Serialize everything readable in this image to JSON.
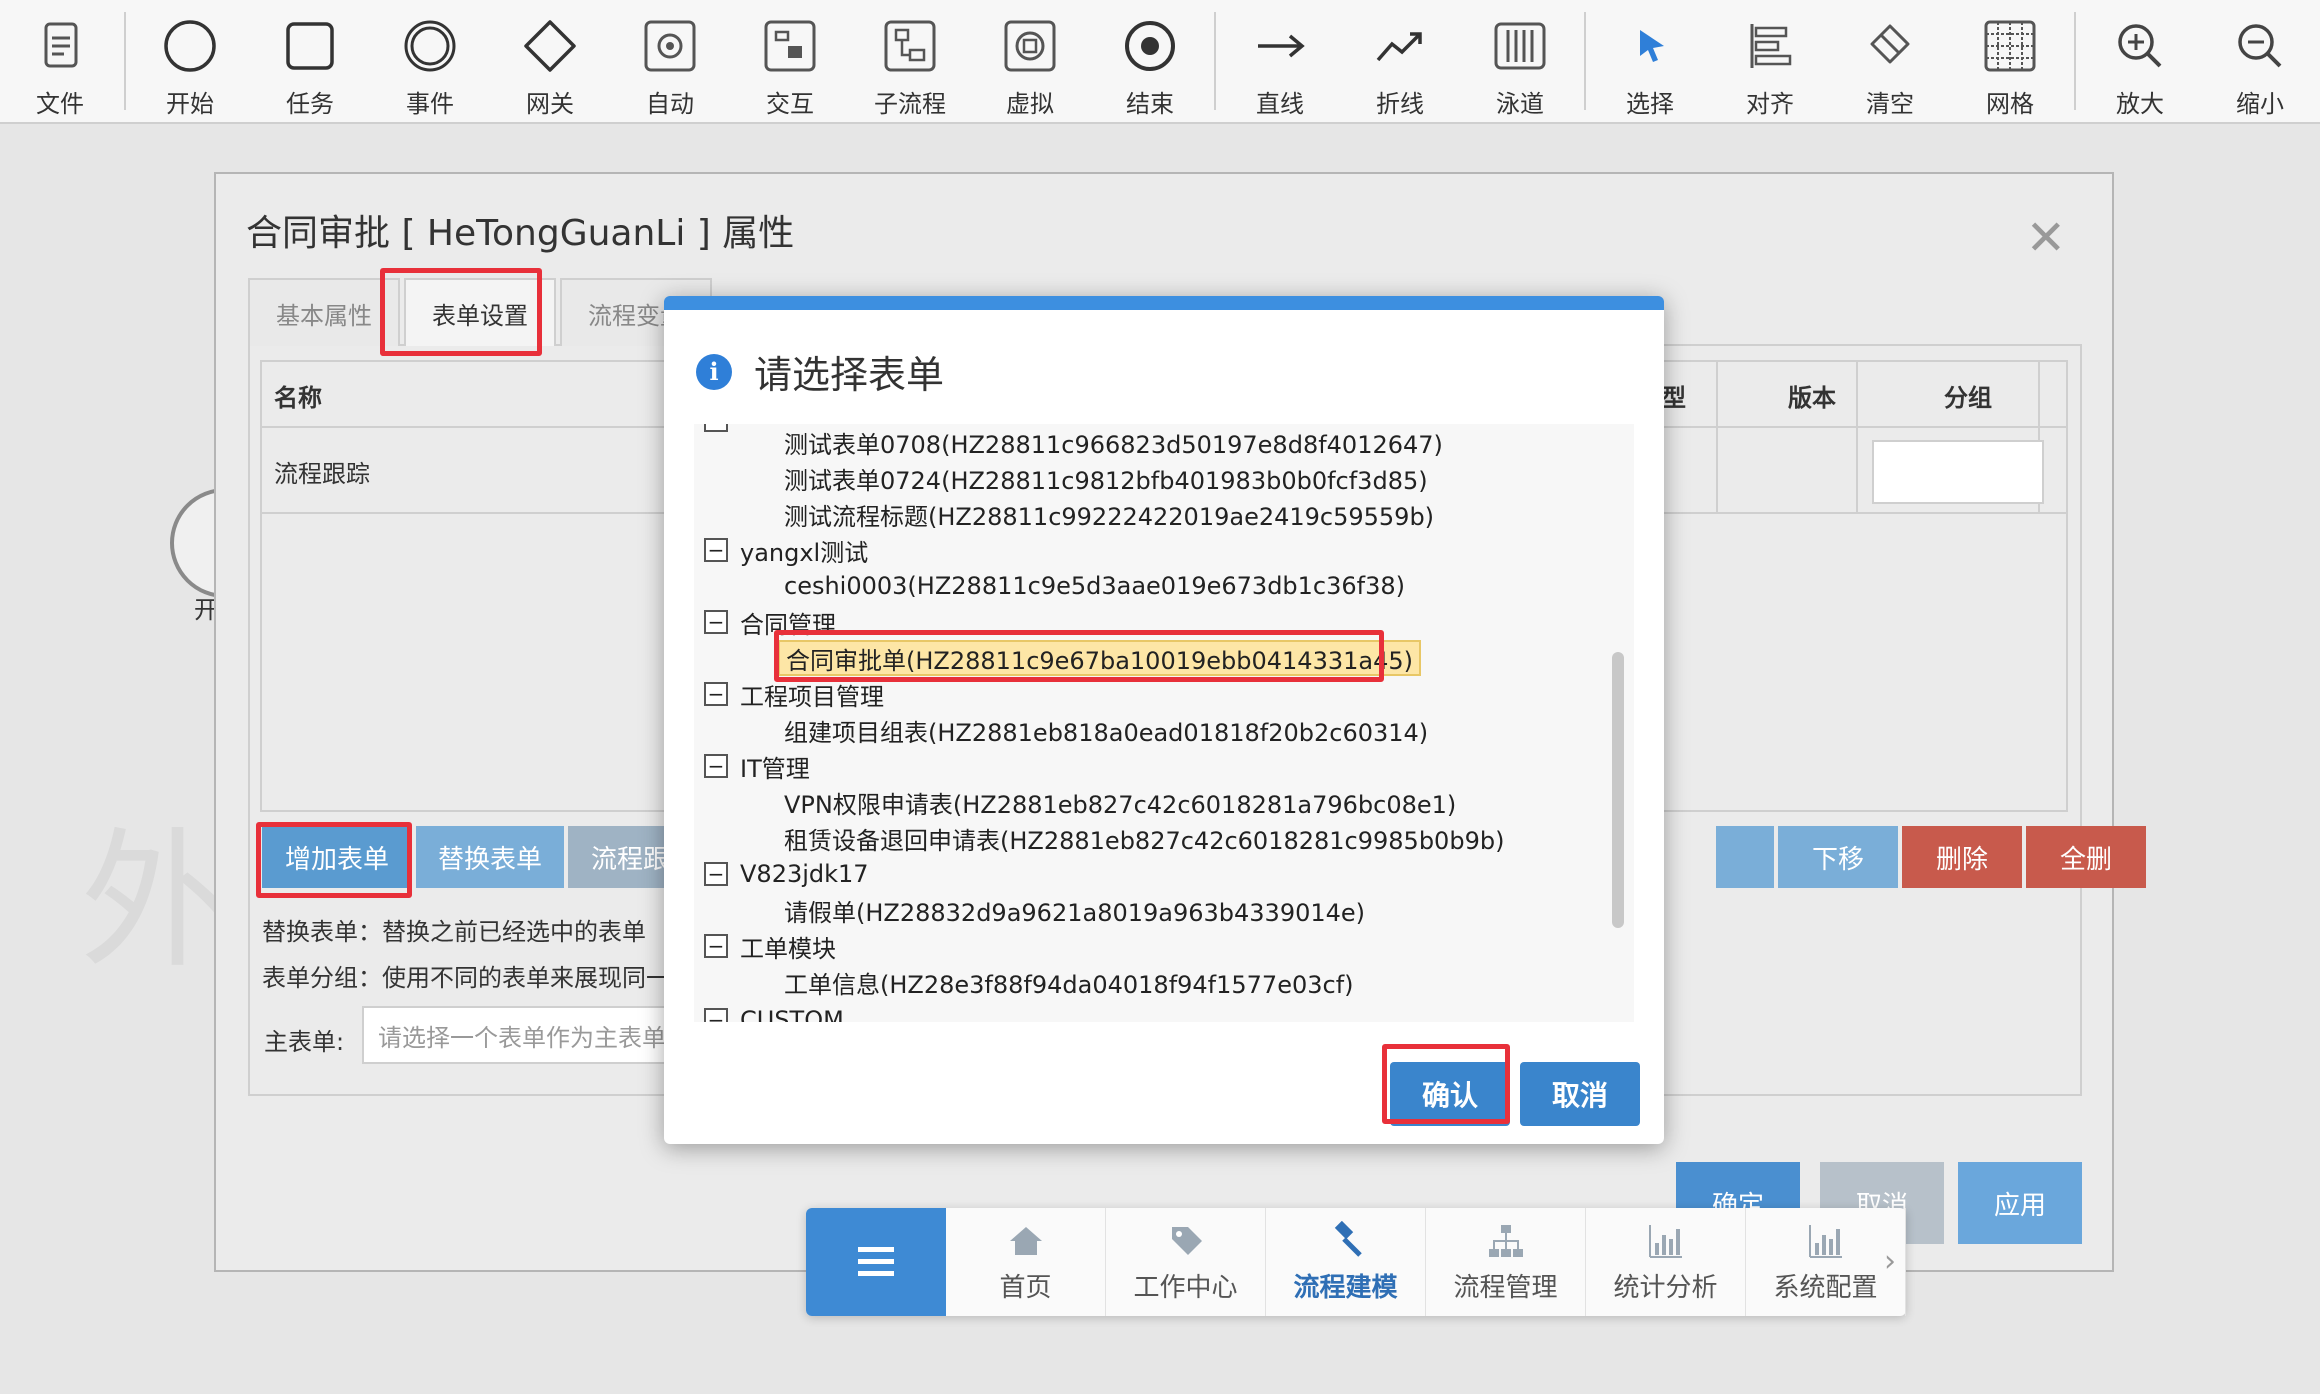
{
  "toolbar": {
    "items": [
      {
        "id": "file",
        "label": "文件",
        "icon": "file-icon"
      },
      {
        "id": "start",
        "label": "开始",
        "icon": "start-circle-icon"
      },
      {
        "id": "task",
        "label": "任务",
        "icon": "task-square-icon"
      },
      {
        "id": "event",
        "label": "事件",
        "icon": "event-ring-icon"
      },
      {
        "id": "gateway",
        "label": "网关",
        "icon": "gateway-diamond-icon"
      },
      {
        "id": "auto",
        "label": "自动",
        "icon": "gear-icon"
      },
      {
        "id": "interact",
        "label": "交互",
        "icon": "interact-icon"
      },
      {
        "id": "subprocess",
        "label": "子流程",
        "icon": "subprocess-icon"
      },
      {
        "id": "virtual",
        "label": "虚拟",
        "icon": "virtual-icon"
      },
      {
        "id": "end",
        "label": "结束",
        "icon": "end-circle-icon"
      },
      {
        "id": "line",
        "label": "直线",
        "icon": "arrow-right-icon"
      },
      {
        "id": "polyline",
        "label": "折线",
        "icon": "polyline-icon"
      },
      {
        "id": "lane",
        "label": "泳道",
        "icon": "swimlane-icon"
      },
      {
        "id": "select",
        "label": "选择",
        "icon": "pointer-icon"
      },
      {
        "id": "align",
        "label": "对齐",
        "icon": "align-icon"
      },
      {
        "id": "clear",
        "label": "清空",
        "icon": "eraser-icon"
      },
      {
        "id": "grid",
        "label": "网格",
        "icon": "grid-icon"
      },
      {
        "id": "zoomin",
        "label": "放大",
        "icon": "zoom-in-icon"
      },
      {
        "id": "zoomout",
        "label": "缩小",
        "icon": "zoom-out-icon"
      }
    ]
  },
  "canvas": {
    "node_label": "开",
    "watermark": "外"
  },
  "prop_dialog": {
    "title": "合同审批 [ HeTongGuanLi ] 属性",
    "close": "✕",
    "tabs": [
      "基本属性",
      "表单设置",
      "流程变量"
    ],
    "table": {
      "headers": {
        "name": "名称",
        "type_partial": "型",
        "version": "版本",
        "group": "分组"
      },
      "rows": [
        {
          "name": "流程跟踪"
        }
      ]
    },
    "buttons": {
      "add": "增加表单",
      "replace": "替换表单",
      "track_partial": "流程跟踪",
      "down": "下移",
      "delete": "删除",
      "delete_all": "全删"
    },
    "help_replace": "替换表单：替换之前已经选中的表单",
    "help_group": "表单分组：使用不同的表单来展现同一",
    "main_form_label": "主表单:",
    "main_form_placeholder": "请选择一个表单作为主表单",
    "footer": {
      "ok": "确定",
      "cancel": "取消",
      "apply": "应用"
    }
  },
  "modal": {
    "title": "请选择表单",
    "tree": [
      {
        "type": "leaf",
        "label": "测试表单0708(HZ28811c966823d50197e8d8f4012647)"
      },
      {
        "type": "leaf",
        "label": "测试表单0724(HZ28811c9812bfb401983b0b0fcf3d85)"
      },
      {
        "type": "leaf",
        "label": "测试流程标题(HZ28811c99222422019ae2419c59559b)"
      },
      {
        "type": "group",
        "label": "yangxl测试",
        "toggle": "−"
      },
      {
        "type": "leaf",
        "label": "ceshi0003(HZ28811c9e5d3aae019e673db1c36f38)"
      },
      {
        "type": "group",
        "label": "合同管理",
        "toggle": "−"
      },
      {
        "type": "leaf",
        "label": "合同审批单(HZ28811c9e67ba10019ebb0414331a45)",
        "selected": true
      },
      {
        "type": "group",
        "label": "工程项目管理",
        "toggle": "−"
      },
      {
        "type": "leaf",
        "label": "组建项目组表(HZ2881eb818a0ead01818f20b2c60314)"
      },
      {
        "type": "group",
        "label": "IT管理",
        "toggle": "−"
      },
      {
        "type": "leaf",
        "label": "VPN权限申请表(HZ2881eb827c42c6018281a796bc08e1)"
      },
      {
        "type": "leaf",
        "label": "租赁设备退回申请表(HZ2881eb827c42c6018281c9985b0b9b)"
      },
      {
        "type": "group",
        "label": "V823jdk17",
        "toggle": "−"
      },
      {
        "type": "leaf",
        "label": "请假单(HZ28832d9a9621a8019a963b4339014e)"
      },
      {
        "type": "group",
        "label": "工单模块",
        "toggle": "−"
      },
      {
        "type": "leaf",
        "label": "工单信息(HZ28e3f88f94da04018f94f1577e03cf)"
      },
      {
        "type": "group",
        "label": "CUSTOM",
        "toggle": "−"
      }
    ],
    "confirm": "确认",
    "cancel": "取消"
  },
  "bottom_nav": {
    "menu_icon": "hamburger-menu-icon",
    "items": [
      {
        "label": "首页",
        "icon": "home-icon"
      },
      {
        "label": "工作中心",
        "icon": "tag-icon"
      },
      {
        "label": "流程建模",
        "icon": "gavel-icon",
        "active": true
      },
      {
        "label": "流程管理",
        "icon": "org-chart-icon"
      },
      {
        "label": "统计分析",
        "icon": "bar-chart-icon"
      },
      {
        "label": "系统配置",
        "icon": "bar-chart-icon"
      }
    ],
    "more": "›"
  },
  "colors": {
    "accent": "#3d8fe0",
    "highlight_box": "#e8303a",
    "selected_row": "#fde6a6",
    "danger": "#c85a4c"
  }
}
